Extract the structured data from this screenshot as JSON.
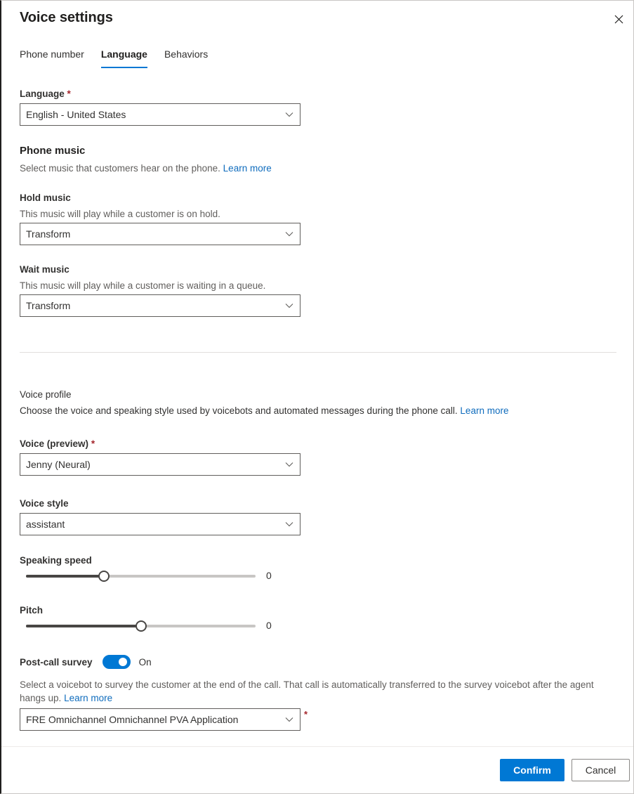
{
  "panel": {
    "title": "Voice settings",
    "close_icon": "close-icon"
  },
  "tabs": [
    {
      "label": "Phone number",
      "active": false
    },
    {
      "label": "Language",
      "active": true
    },
    {
      "label": "Behaviors",
      "active": false
    }
  ],
  "language": {
    "label": "Language",
    "required_marker": "*",
    "value": "English - United States"
  },
  "phone_music": {
    "heading": "Phone music",
    "description": "Select music that customers hear on the phone.",
    "learn_more": "Learn more",
    "hold": {
      "label": "Hold music",
      "description": "This music will play while a customer is on hold.",
      "value": "Transform"
    },
    "wait": {
      "label": "Wait music",
      "description": "This music will play while a customer is waiting in a queue.",
      "value": "Transform"
    }
  },
  "voice_profile": {
    "heading": "Voice profile",
    "description": "Choose the voice and speaking style used by voicebots and automated messages during the phone call.",
    "learn_more": "Learn more",
    "voice": {
      "label": "Voice (preview)",
      "required_marker": "*",
      "value": "Jenny (Neural)"
    },
    "style": {
      "label": "Voice style",
      "value": "assistant"
    },
    "speaking_speed": {
      "label": "Speaking speed",
      "value": "0",
      "percent": 34
    },
    "pitch": {
      "label": "Pitch",
      "value": "0",
      "percent": 50
    }
  },
  "post_call_survey": {
    "label": "Post-call survey",
    "toggle_state": "On",
    "toggle_on": true,
    "description": "Select a voicebot to survey the customer at the end of the call. That call is automatically transferred to the survey voicebot after the agent hangs up.",
    "learn_more": "Learn more",
    "voicebot_value": "FRE Omnichannel Omnichannel PVA Application",
    "required_marker": "*"
  },
  "footer": {
    "confirm_label": "Confirm",
    "cancel_label": "Cancel"
  },
  "colors": {
    "accent": "#0078d4",
    "required": "#a4262c",
    "link": "#0f6cbd"
  }
}
